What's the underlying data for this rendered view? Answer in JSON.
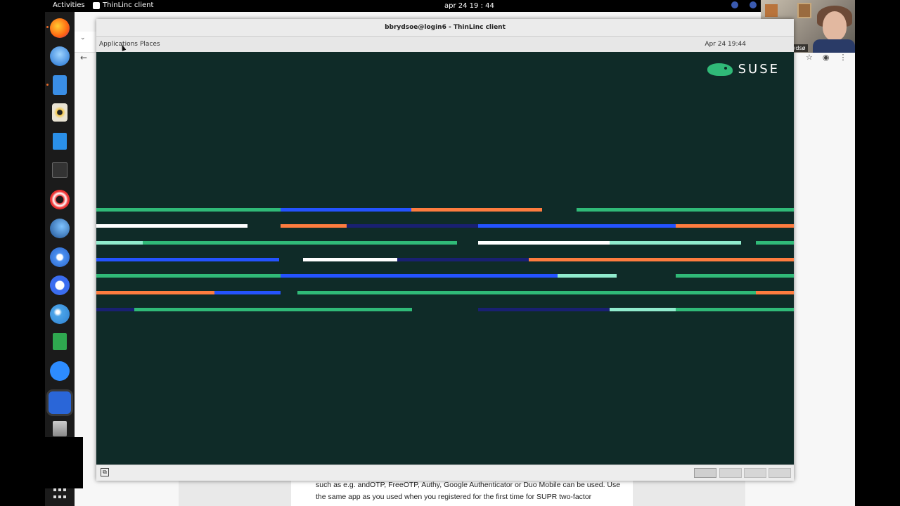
{
  "topbar": {
    "activities": "Activities",
    "app_name": "ThinLinc client",
    "clock": "apr 24  19 : 44"
  },
  "webcam": {
    "name": "Birgitte Brydsø"
  },
  "browser": {
    "doc_line1": "such as e.g. andOTP, FreeOTP, Authy, Google Authenticator or Duo Mobile can be used. Use",
    "doc_line2": "the same app as you used when you registered for the first time for SUPR two-factor"
  },
  "window": {
    "title": "bbrydsoe@login6 - ThinLinc client",
    "menu_applications": "Applications",
    "menu_places": "Places",
    "clock": "Apr 24  19:44",
    "logo_text": "SUSE"
  },
  "colors": {
    "desktop_bg": "#0f2b28",
    "suse_green": "#30ba78",
    "suse_blue": "#2453ff",
    "suse_orange": "#fe7c3f",
    "suse_navy": "#192072",
    "suse_mint": "#90ebcd",
    "white": "#ffffff"
  },
  "dock_icons": [
    "firefox-icon",
    "thunderbird-icon",
    "files-icon",
    "rhythmbox-icon",
    "writer-icon",
    "terminal-icon",
    "help-icon",
    "steam-icon",
    "chrome-icon",
    "signal-icon",
    "telegram-icon",
    "calc-icon",
    "zoom-icon",
    "thinlinc-icon",
    "trash-icon",
    "app-grid-icon"
  ]
}
